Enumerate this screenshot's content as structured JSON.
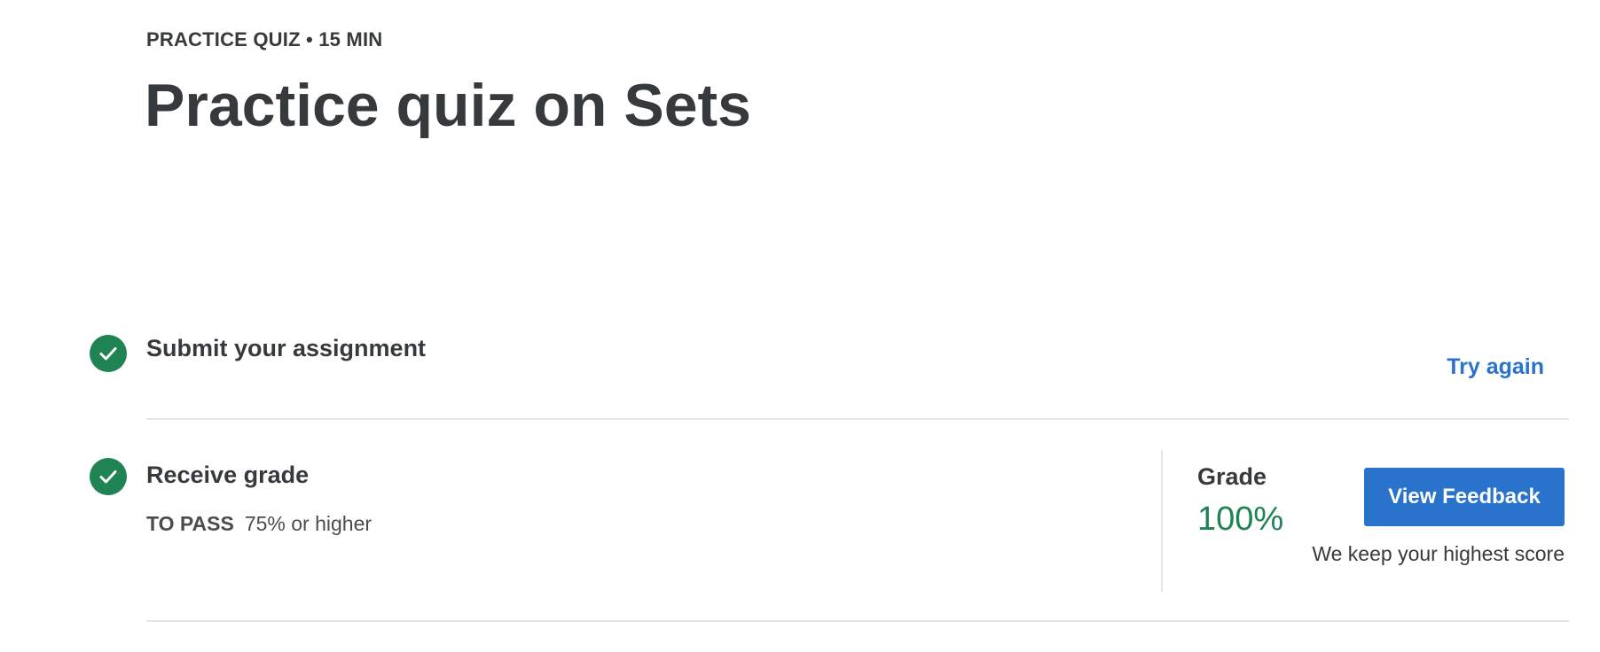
{
  "header": {
    "eyebrow": "PRACTICE QUIZ • 15 MIN",
    "title": "Practice quiz on Sets"
  },
  "steps": [
    {
      "title": "Submit your assignment",
      "status": "complete",
      "action_label": "Try again"
    },
    {
      "title": "Receive grade",
      "status": "complete",
      "pass_label": "TO PASS",
      "pass_requirement": "75% or higher"
    }
  ],
  "grade": {
    "label": "Grade",
    "value": "100%",
    "button_label": "View Feedback",
    "note": "We keep your highest score"
  },
  "icons": {
    "step_status": "check-circle-icon"
  },
  "colors": {
    "success": "#1f8354",
    "link": "#2a73cc",
    "primary_button": "#2a73cc",
    "text": "#373a3c",
    "divider": "#e5e5e5"
  }
}
